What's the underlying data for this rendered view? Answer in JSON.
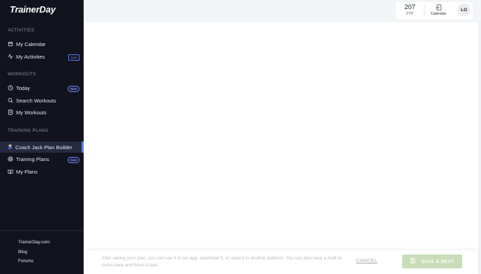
{
  "app": {
    "logo": "TrainerDay"
  },
  "sidebar": {
    "sections": {
      "activities": "ACTIVITIES",
      "workouts": "WORKOUTS",
      "training_plans": "TRAINING PLANS"
    },
    "items": [
      {
        "label": "My Calendar",
        "icon": "calendar-icon"
      },
      {
        "label": "My Activities",
        "icon": "activity-icon",
        "badge": "Live"
      },
      {
        "label": "Today",
        "icon": "clock-icon",
        "badge": "New"
      },
      {
        "label": "Search Workouts",
        "icon": "search-icon"
      },
      {
        "label": "My Workouts",
        "icon": "list-icon"
      },
      {
        "label": "Coach Jack Plan Builder",
        "icon": "coach-jack-avatar-icon",
        "active": true
      },
      {
        "label": "Training Plans",
        "icon": "target-icon",
        "badge": "New"
      },
      {
        "label": "My Plans",
        "icon": "book-icon"
      }
    ],
    "footer_links": [
      "TrainerDay.com",
      "Blog",
      "Forums"
    ]
  },
  "topbar": {
    "ftp_value": "207",
    "ftp_label": "FTP",
    "calendar_label": "Calendar",
    "user_initials": "LO"
  },
  "action_bar": {
    "message": "After saving your plan, you can use it in our app, download it, or send it to another platform. You can also save a draft to come back and finish it later.",
    "cancel_label": "CANCEL",
    "save_label": "SAVE & NEXT"
  },
  "colors": {
    "sidebar_bg": "#12131d",
    "accent": "#5b7cf0",
    "save_button_disabled": "#c8ddb8"
  }
}
